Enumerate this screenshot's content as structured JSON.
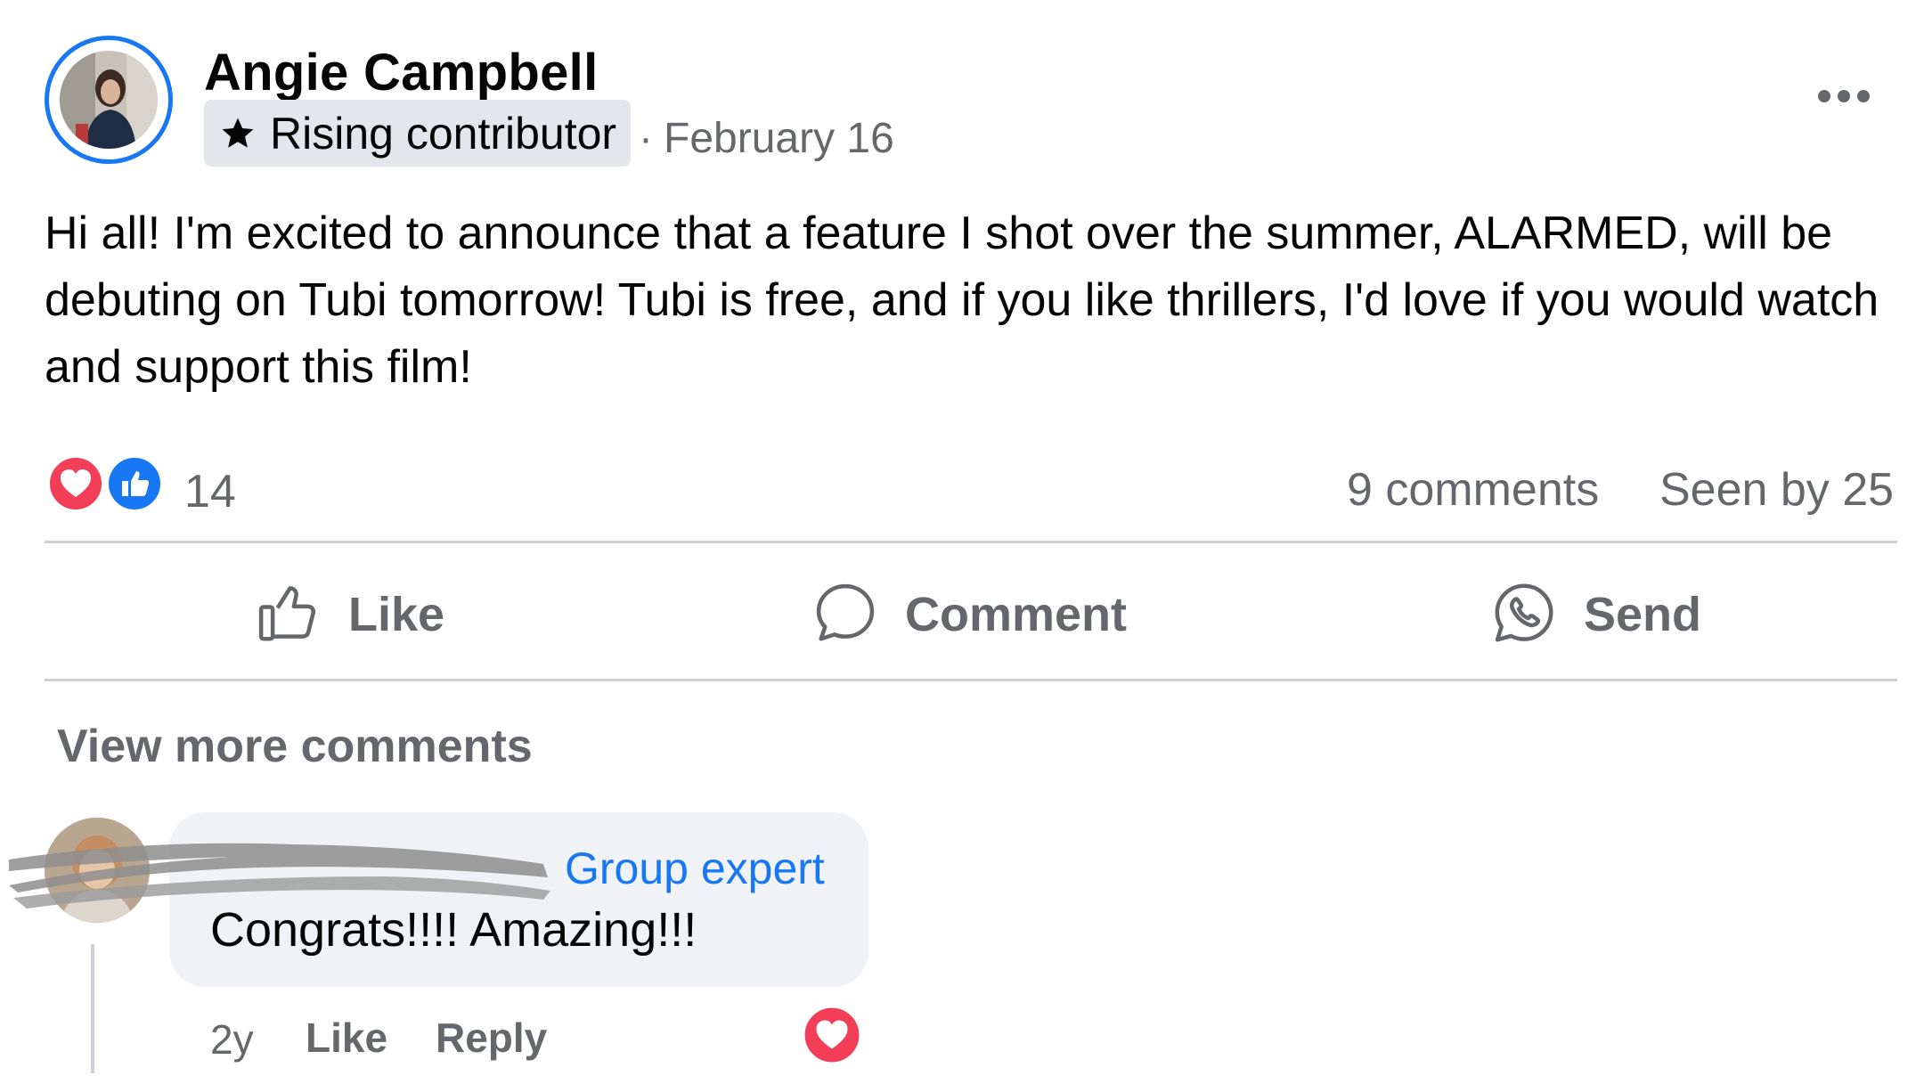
{
  "post": {
    "author": "Angie Campbell",
    "badge": "Rising contributor",
    "date_separator": "·",
    "date": "February 16",
    "text": "Hi all! I'm excited to announce that a feature I shot over the summer, ALARMED, will be debuting on Tubi tomorrow! Tubi is free, and if you like thrillers, I'd love if you would watch and support this film!"
  },
  "reactions": {
    "icons": [
      "love-icon",
      "like-icon"
    ],
    "count": "14",
    "comments": "9 comments",
    "seen_by": "Seen by 25"
  },
  "actions": {
    "like": "Like",
    "comment": "Comment",
    "send": "Send"
  },
  "comments_section": {
    "view_more": "View more comments",
    "comment": {
      "badge": "Group expert",
      "text": "Congrats!!!! Amazing!!!",
      "time": "2y",
      "like": "Like",
      "reply": "Reply",
      "reaction_icon": "love-icon"
    }
  },
  "colors": {
    "accent": "#1877f2",
    "love": "#f33e58",
    "muted_text": "#65676b",
    "bubble": "#f0f2f5"
  }
}
